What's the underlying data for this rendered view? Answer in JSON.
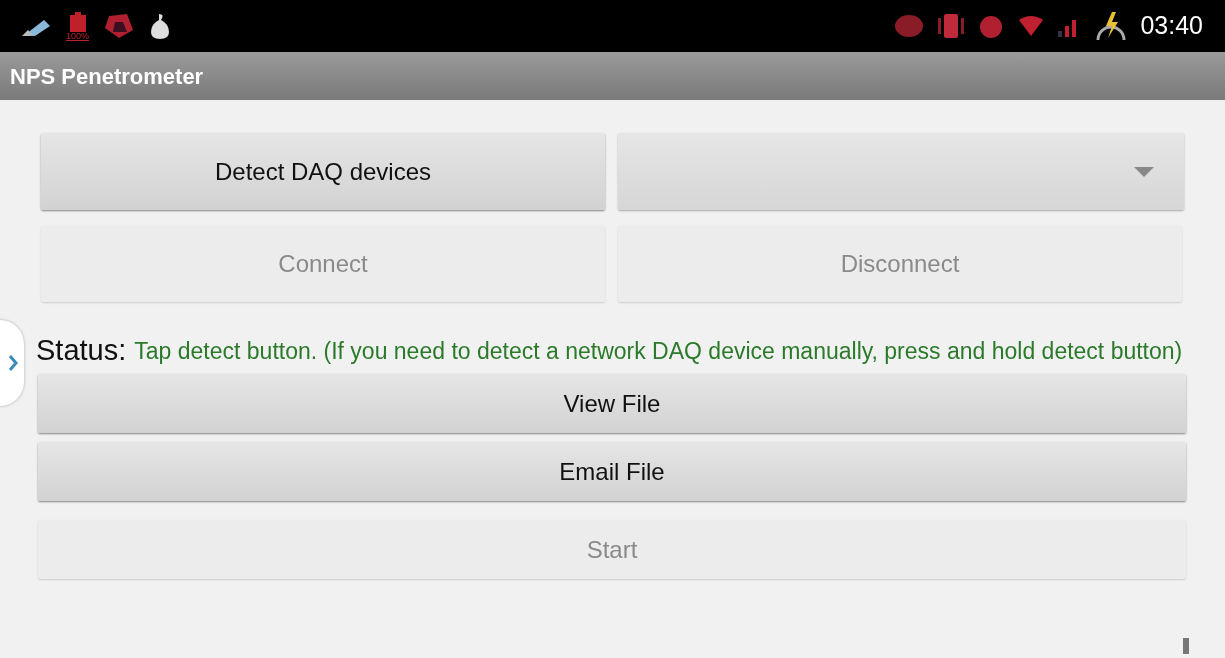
{
  "status_bar": {
    "battery_label": "100%",
    "time": "03:40"
  },
  "app_bar": {
    "title": "NPS Penetrometer"
  },
  "device_row": {
    "detect_button": {
      "label": "Detect DAQ devices",
      "disabled": false
    },
    "device_dropdown": {
      "expanded": false
    }
  },
  "connection_buttons": [
    {
      "label": "Connect",
      "disabled": true
    },
    {
      "label": "Disconnect",
      "disabled": true
    }
  ],
  "status": {
    "label": "Status:",
    "message": "Tap detect button. (If you need to detect a network DAQ device manually, press and hold detect button)"
  },
  "actions": [
    {
      "label": "View File",
      "disabled": false
    },
    {
      "label": "Email File",
      "disabled": false
    },
    {
      "label": "Start",
      "disabled": true
    }
  ]
}
